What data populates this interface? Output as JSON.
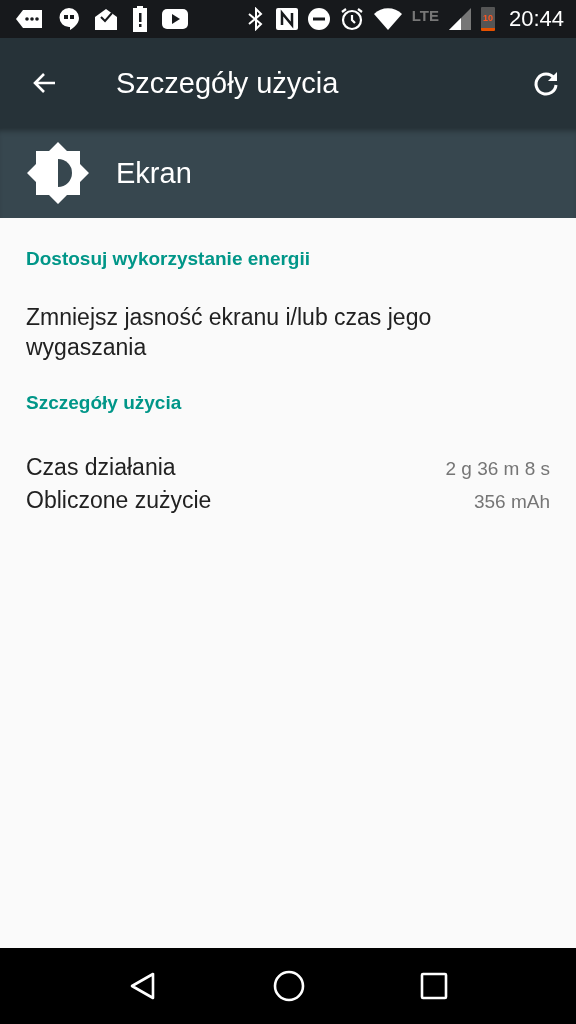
{
  "status_bar": {
    "network": "LTE",
    "battery": "10",
    "time": "20:44"
  },
  "toolbar": {
    "title": "Szczegóły użycia"
  },
  "app_header": {
    "name": "Ekran"
  },
  "sections": [
    {
      "title": "Dostosuj wykorzystanie energii",
      "kind": "action",
      "items": [
        {
          "text": "Zmniejsz jasność ekranu i/lub czas jego wygaszania"
        }
      ]
    },
    {
      "title": "Szczegóły użycia",
      "kind": "details",
      "items": [
        {
          "label": "Czas działania",
          "value": "2 g 36 m 8 s"
        },
        {
          "label": "Obliczone zużycie",
          "value": "356 mAh"
        }
      ]
    }
  ]
}
